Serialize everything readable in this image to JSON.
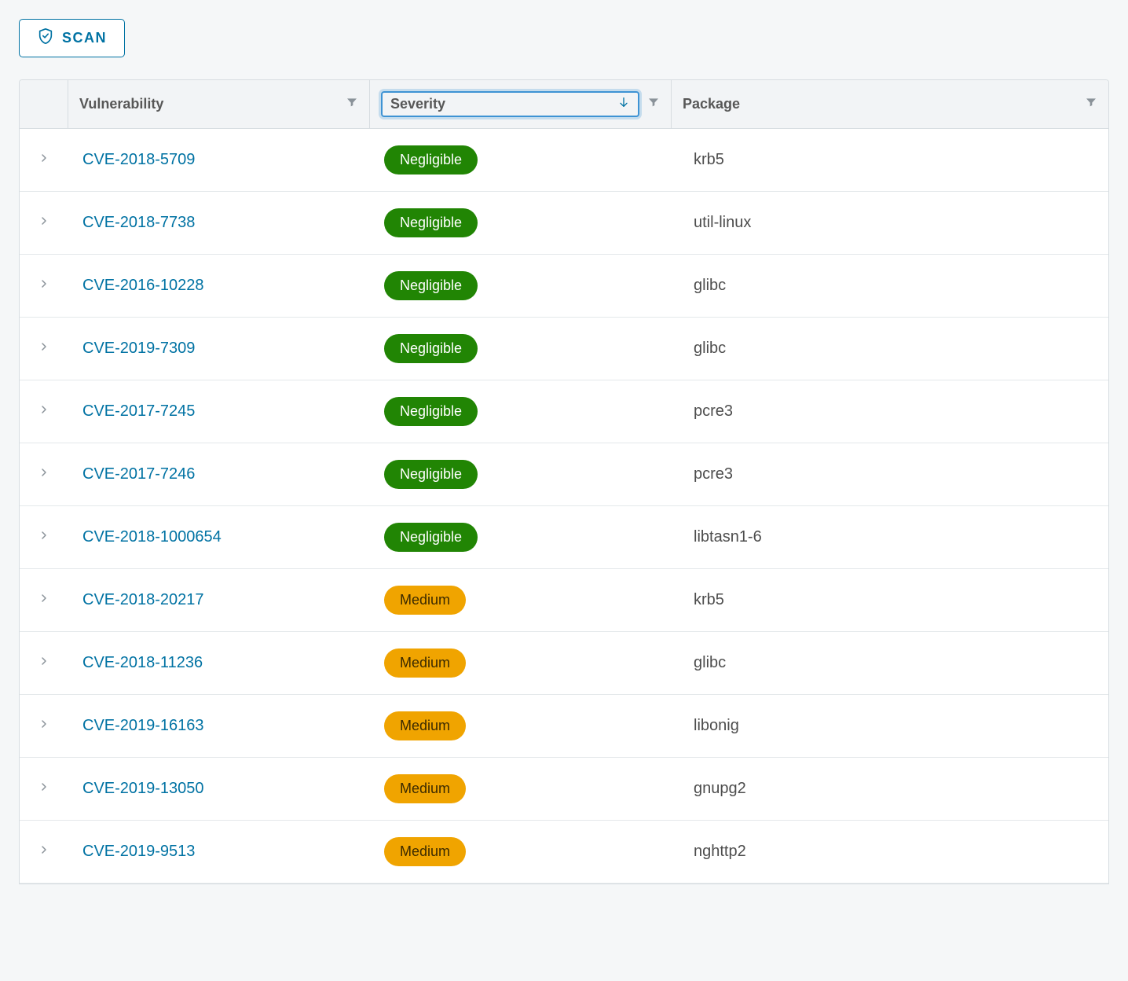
{
  "toolbar": {
    "scan_label": "SCAN"
  },
  "table": {
    "columns": {
      "vulnerability": "Vulnerability",
      "severity": "Severity",
      "package": "Package"
    },
    "sort": {
      "column": "severity",
      "direction": "asc"
    },
    "rows": [
      {
        "cve": "CVE-2018-5709",
        "severity": "Negligible",
        "severity_key": "negligible",
        "package": "krb5"
      },
      {
        "cve": "CVE-2018-7738",
        "severity": "Negligible",
        "severity_key": "negligible",
        "package": "util-linux"
      },
      {
        "cve": "CVE-2016-10228",
        "severity": "Negligible",
        "severity_key": "negligible",
        "package": "glibc"
      },
      {
        "cve": "CVE-2019-7309",
        "severity": "Negligible",
        "severity_key": "negligible",
        "package": "glibc"
      },
      {
        "cve": "CVE-2017-7245",
        "severity": "Negligible",
        "severity_key": "negligible",
        "package": "pcre3"
      },
      {
        "cve": "CVE-2017-7246",
        "severity": "Negligible",
        "severity_key": "negligible",
        "package": "pcre3"
      },
      {
        "cve": "CVE-2018-1000654",
        "severity": "Negligible",
        "severity_key": "negligible",
        "package": "libtasn1-6"
      },
      {
        "cve": "CVE-2018-20217",
        "severity": "Medium",
        "severity_key": "medium",
        "package": "krb5"
      },
      {
        "cve": "CVE-2018-11236",
        "severity": "Medium",
        "severity_key": "medium",
        "package": "glibc"
      },
      {
        "cve": "CVE-2019-16163",
        "severity": "Medium",
        "severity_key": "medium",
        "package": "libonig"
      },
      {
        "cve": "CVE-2019-13050",
        "severity": "Medium",
        "severity_key": "medium",
        "package": "gnupg2"
      },
      {
        "cve": "CVE-2019-9513",
        "severity": "Medium",
        "severity_key": "medium",
        "package": "nghttp2"
      }
    ]
  }
}
